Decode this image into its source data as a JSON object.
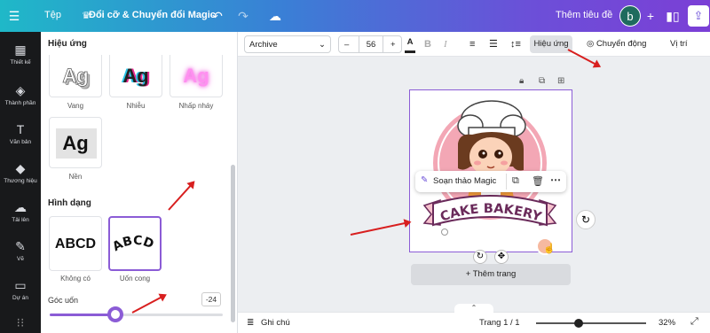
{
  "topbar": {
    "menu_file": "Tệp",
    "doc_title": "Đổi cỡ & Chuyển đổi Magic",
    "add_title": "Thêm tiêu đề",
    "avatar_letter": "b"
  },
  "rail": [
    {
      "icon": "grid-icon",
      "label": "Thiết kế"
    },
    {
      "icon": "shapes-icon",
      "label": "Thành phần"
    },
    {
      "icon": "text-icon",
      "label": "Văn bản"
    },
    {
      "icon": "brand-icon",
      "label": "Thương hiệu"
    },
    {
      "icon": "upload-icon",
      "label": "Tải lên"
    },
    {
      "icon": "draw-icon",
      "label": "Vẽ"
    },
    {
      "icon": "folder-icon",
      "label": "Dự án"
    }
  ],
  "panel": {
    "effects_title": "Hiệu ứng",
    "effects": [
      "Vang",
      "Nhiễu",
      "Nhấp nháy",
      "Nền"
    ],
    "shape_title": "Hình dạng",
    "shapes": [
      {
        "preview": "ABCD",
        "label": "Không có"
      },
      {
        "preview": "ABCD",
        "label": "Uốn cong"
      }
    ],
    "curve_label": "Góc uốn",
    "curve_value": "-24",
    "curve_level": 0.38
  },
  "toolbar": {
    "font": "Archive",
    "minus": "–",
    "font_size": "56",
    "plus": "+",
    "effects_btn": "Hiệu ứng",
    "animate_btn": "Chuyển động",
    "position_btn": "Vị trí"
  },
  "canvas": {
    "magic_edit": "Soạn thảo Magic",
    "banner_text": "CAKE BAKERY",
    "add_page": "+ Thêm trang"
  },
  "bottom": {
    "notes": "Ghi chú",
    "page_indicator": "Trang 1 / 1",
    "zoom": "32%",
    "zoom_level": 0.32
  },
  "colors": {
    "accent": "#8b5cd6",
    "annotation_arrow": "#d81f1f"
  }
}
